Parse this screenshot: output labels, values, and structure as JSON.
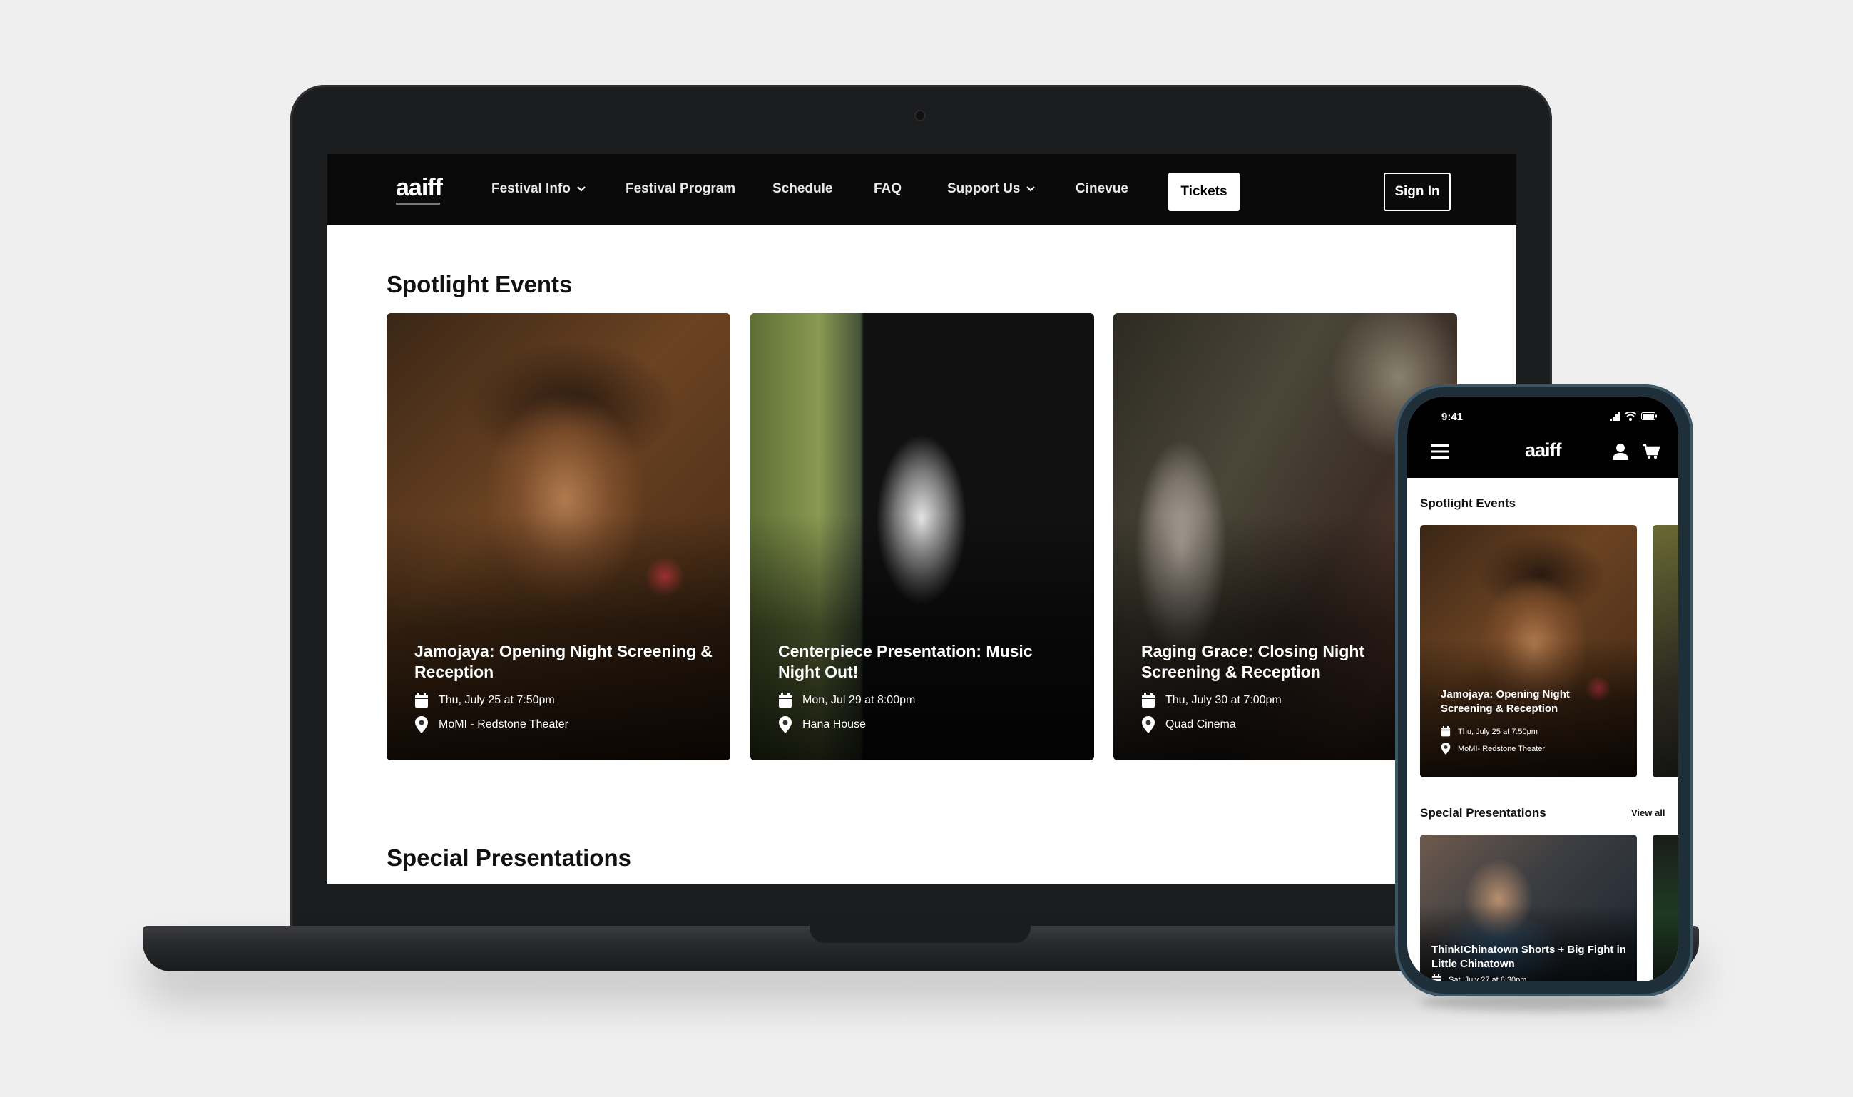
{
  "desktop": {
    "nav": {
      "logo": "aaiff",
      "items": [
        {
          "label": "Festival Info",
          "has_dropdown": true
        },
        {
          "label": "Festival Program",
          "has_dropdown": false
        },
        {
          "label": "Schedule",
          "has_dropdown": false
        },
        {
          "label": "FAQ",
          "has_dropdown": false
        },
        {
          "label": "Support Us",
          "has_dropdown": true
        },
        {
          "label": "Cinevue",
          "has_dropdown": false
        }
      ],
      "tickets_label": "Tickets",
      "signin_label": "Sign In"
    },
    "spotlight_title": "Spotlight Events",
    "special_title": "Special Presentations",
    "events": [
      {
        "title": "Jamojaya: Opening Night Screening & Reception",
        "date": "Thu, July 25 at 7:50pm",
        "venue": "MoMI - Redstone Theater"
      },
      {
        "title": "Centerpiece Presentation: Music Night Out!",
        "date": "Mon, Jul 29 at 8:00pm",
        "venue": "Hana House"
      },
      {
        "title": "Raging Grace: Closing Night Screening & Reception",
        "date": "Thu, July 30 at 7:00pm",
        "venue": "Quad Cinema"
      }
    ]
  },
  "mobile": {
    "status_time": "9:41",
    "logo": "aaiff",
    "spotlight_title": "Spotlight Events",
    "spotlight_card": {
      "title": "Jamojaya: Opening Night Screening & Reception",
      "date": "Thu, July 25 at 7:50pm",
      "venue": "MoMI- Redstone Theater"
    },
    "special_title": "Special Presentations",
    "view_all": "View all",
    "special_card": {
      "title": "Think!Chinatown Shorts + Big Fight in Little Chinatown",
      "date": "Sat, July 27 at 6:30pm"
    }
  }
}
